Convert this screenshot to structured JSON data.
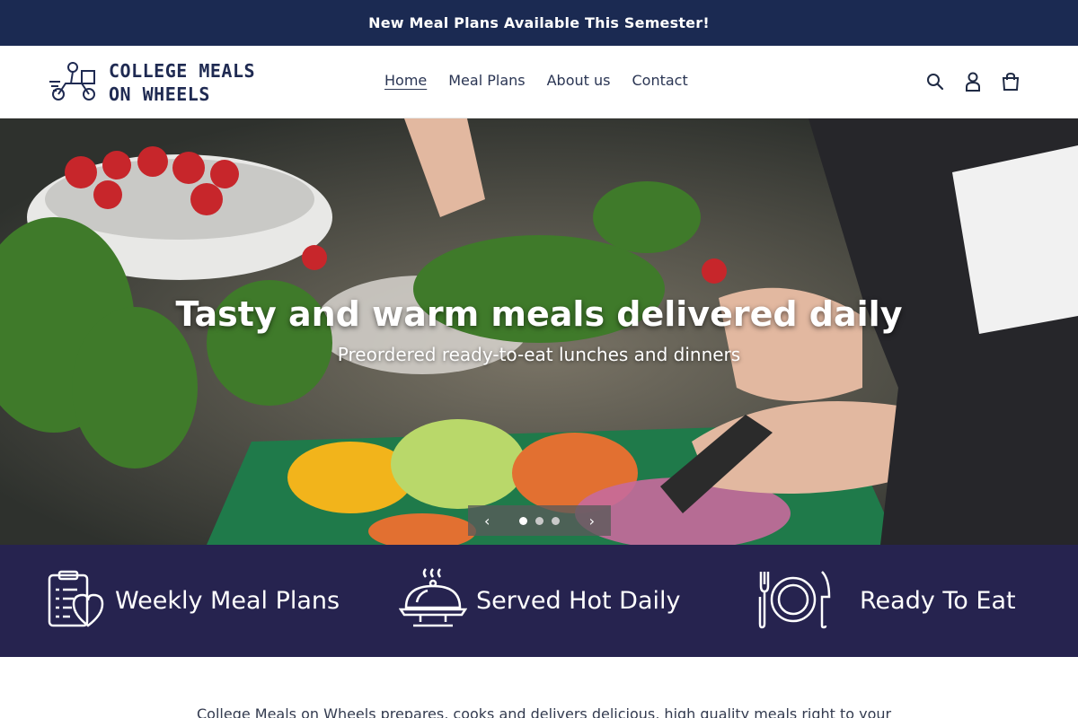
{
  "announcement": {
    "text": "New Meal Plans Available This Semester!"
  },
  "logo": {
    "line1": "COLLEGE MEALS",
    "line2": "ON WHEELS",
    "icon": "delivery-scooter-icon"
  },
  "nav": [
    {
      "label": "Home",
      "active": true
    },
    {
      "label": "Meal Plans",
      "active": false
    },
    {
      "label": "About us",
      "active": false
    },
    {
      "label": "Contact",
      "active": false
    }
  ],
  "header_icons": [
    "search-icon",
    "account-icon",
    "cart-icon"
  ],
  "hero": {
    "title": "Tasty and warm meals delivered daily",
    "subtitle": "Preordered ready-to-eat lunches and dinners",
    "slide_count": 3,
    "active_slide": 1
  },
  "features": [
    {
      "label": "Weekly Meal Plans",
      "icon": "clipboard-heart-icon"
    },
    {
      "label": "Served Hot Daily",
      "icon": "cloche-icon"
    },
    {
      "label": "Ready To Eat",
      "icon": "plate-fork-knife-icon"
    }
  ],
  "intro": {
    "text": "College Meals on Wheels prepares, cooks and delivers delicious, high quality meals right to your"
  },
  "colors": {
    "announcement_bg": "#1b2a52",
    "features_bg": "#26234f",
    "logo_text": "#1f2a52"
  }
}
